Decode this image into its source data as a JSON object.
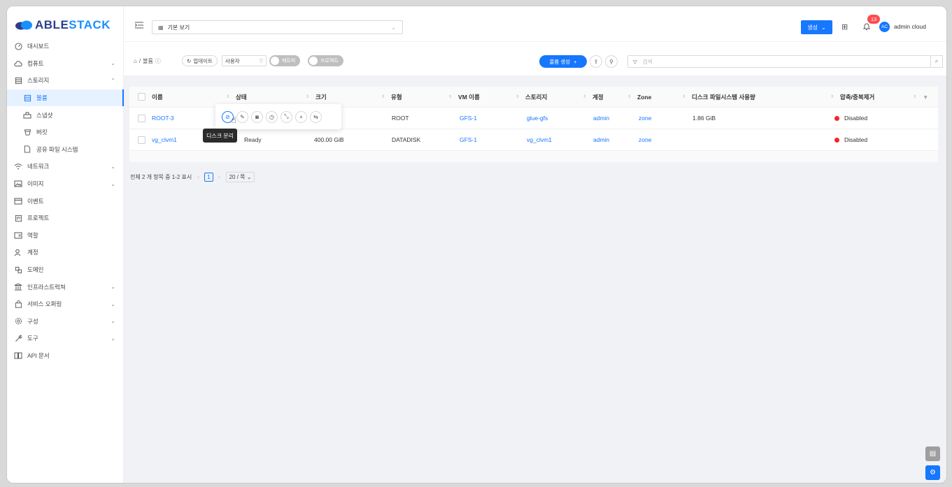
{
  "brand": {
    "name_prefix": "ABLE",
    "name_suffix": "STACK"
  },
  "sidebar": {
    "items": [
      {
        "label": "대시보드",
        "icon": "dashboard-icon",
        "expandable": false
      },
      {
        "label": "컴퓨트",
        "icon": "cloud-icon",
        "expandable": true
      },
      {
        "label": "스토리지",
        "icon": "database-icon",
        "expandable": true,
        "expanded": true
      },
      {
        "label": "볼륨",
        "icon": "database-icon",
        "sub": true,
        "active": true
      },
      {
        "label": "스냅샷",
        "icon": "snapshot-icon",
        "sub": true
      },
      {
        "label": "버킷",
        "icon": "bucket-icon",
        "sub": true
      },
      {
        "label": "공유 파일 시스템",
        "icon": "file-icon",
        "sub": true
      },
      {
        "label": "네트워크",
        "icon": "wifi-icon",
        "expandable": true
      },
      {
        "label": "이미지",
        "icon": "picture-icon",
        "expandable": true
      },
      {
        "label": "이벤트",
        "icon": "schedule-icon"
      },
      {
        "label": "프로젝트",
        "icon": "project-icon"
      },
      {
        "label": "역할",
        "icon": "idcard-icon"
      },
      {
        "label": "계정",
        "icon": "team-icon"
      },
      {
        "label": "도메인",
        "icon": "block-icon"
      },
      {
        "label": "인프라스트럭쳐",
        "icon": "bank-icon",
        "expandable": true
      },
      {
        "label": "서비스 오퍼링",
        "icon": "shopping-icon",
        "expandable": true
      },
      {
        "label": "구성",
        "icon": "setting-icon",
        "expandable": true
      },
      {
        "label": "도구",
        "icon": "tool-icon",
        "expandable": true
      },
      {
        "label": "API 문서",
        "icon": "read-icon"
      }
    ]
  },
  "topbar": {
    "view_select": "기본 보기",
    "create_label": "생성",
    "notification_count": "13",
    "avatar_initials": "AC",
    "username": "admin cloud"
  },
  "toolbar": {
    "breadcrumb": [
      "볼륨"
    ],
    "refresh_label": "업데이트",
    "user_filter": "사용자",
    "toggle_metrics": "메트릭",
    "toggle_project": "프로젝트",
    "create_volume_label": "볼륨 생성",
    "search_placeholder": "검색"
  },
  "table": {
    "columns": [
      "이름",
      "상태",
      "크기",
      "유형",
      "VM 이름",
      "스토리지",
      "계정",
      "Zone",
      "디스크 파일시스템 사용량",
      "압축/중복제거"
    ],
    "rows": [
      {
        "name": "ROOT-3",
        "state": "",
        "size": "",
        "type": "ROOT",
        "vm": "GFS-1",
        "storage": "glue-gfs",
        "account": "admin",
        "zone": "zone",
        "fs_usage": "1.86 GiB",
        "dedup": "Disabled"
      },
      {
        "name": "vg_clvm1",
        "state": "Ready",
        "size": "400.00 GiB",
        "type": "DATADISK",
        "vm": "GFS-1",
        "storage": "vg_clvm1",
        "account": "admin",
        "zone": "zone",
        "fs_usage": "",
        "dedup": "Disabled"
      }
    ]
  },
  "pagination": {
    "summary": "전체 2 개 항목 중 1-2 표시",
    "current_page": "1",
    "page_size": "20 / 쪽"
  },
  "popover": {
    "tooltip": "디스크 분리",
    "actions": [
      "detach-disk-icon",
      "edit-icon",
      "snapshot-icon",
      "schedule-icon",
      "resize-icon",
      "plus-icon",
      "migrate-icon"
    ]
  },
  "colors": {
    "primary": "#1677ff",
    "danger": "#f5222d",
    "badge": "#ff4d4f"
  }
}
